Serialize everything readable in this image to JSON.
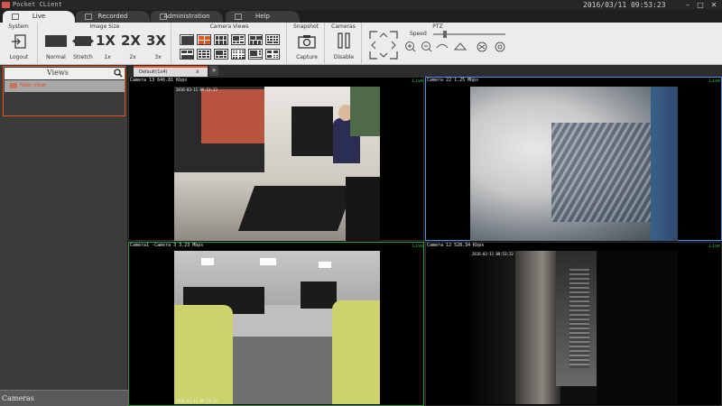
{
  "app": {
    "title": "Pocket CLient",
    "clock": "2016/03/11 09:53:23",
    "window_controls": [
      "minimize-icon",
      "maximize-icon",
      "close-icon"
    ]
  },
  "tabs": [
    {
      "label": "Live",
      "icon": "live-icon",
      "active": true
    },
    {
      "label": "Recorded",
      "icon": "play-icon",
      "active": false
    },
    {
      "label": "Administration",
      "icon": "admin-icon",
      "active": false
    },
    {
      "label": "Help",
      "icon": "help-icon",
      "active": false
    }
  ],
  "ribbon": {
    "system": {
      "title": "System",
      "logout": "Logout"
    },
    "image_size": {
      "title": "Image Size",
      "normal": "Normal",
      "stretch": "Stretch",
      "x1": "1x",
      "x2": "2x",
      "x3": "3x",
      "x1_glyph": "1X",
      "x2_glyph": "2X",
      "x3_glyph": "3X"
    },
    "camera_views": {
      "title": "Camera Views"
    },
    "snapshot": {
      "title": "Snapshot",
      "capture": "Capture"
    },
    "cameras": {
      "title": "Cameras",
      "disable": "Disable"
    },
    "ptz": {
      "title": "PTZ",
      "speed": "Speed",
      "speed_level": 0.15
    }
  },
  "views_panel": {
    "title": "Views",
    "item": "New view"
  },
  "cameras_panel": {
    "title": "Cameras"
  },
  "view_tab": {
    "label": "Default(1x4)",
    "close": "x",
    "add": "+"
  },
  "panes": [
    {
      "label": "Camera 13   646.81 Kbps",
      "live": "Live",
      "stamp": "2016-03-11 09:53:23"
    },
    {
      "label": "Camera 22   1.25 Mbps",
      "live": "Live",
      "stamp": ""
    },
    {
      "label": "Camera1 -Camera 3   3.23 Mbps",
      "live": "Live",
      "stamp": "2016-03-11 09:53:23"
    },
    {
      "label": "Camera 12   528.34 Kbps",
      "live": "Live",
      "stamp": "2016-03-11 09:53:22"
    }
  ],
  "colors": {
    "accent": "#e2531e",
    "live": "#35c24a",
    "selected_blue": "#5a8fe0",
    "selected_green": "#2c9a3a"
  }
}
